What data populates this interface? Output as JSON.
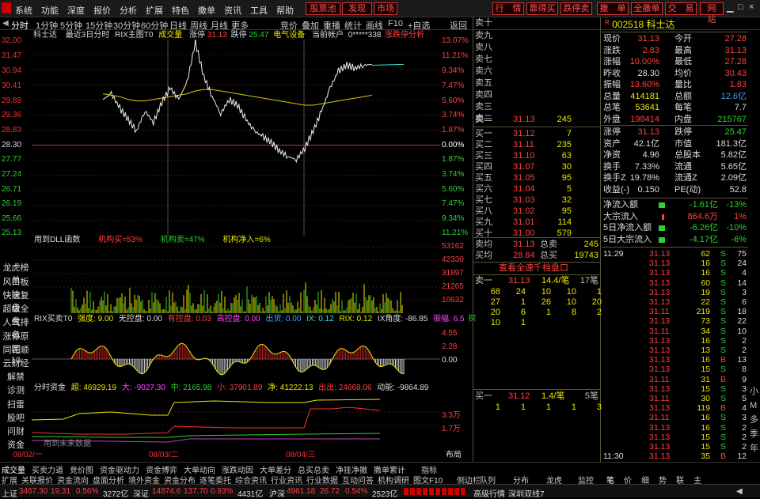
{
  "menu": [
    "系统",
    "功能",
    "深度",
    "报价",
    "分析",
    "扩展",
    "特色",
    "撒单",
    "资讯",
    "工具",
    "帮助"
  ],
  "top_badges": [
    "股票池",
    "发现",
    "市场"
  ],
  "top_buttons": [
    "行　情",
    "靠得买",
    "跌停卖",
    "撒　单",
    "全撒单",
    "交　易",
    "网　站"
  ],
  "tabs": [
    "分时",
    "1分钟",
    "5分钟",
    "15分钟",
    "30分钟",
    "60分钟",
    "日线",
    "周线",
    "月线",
    "更多"
  ],
  "tools": [
    "竞价",
    "叠加",
    "重播",
    "统计",
    "画线",
    "F10",
    "+自选",
    "返回"
  ],
  "chart_header": {
    "name": "科士达",
    "label": "最近3日分时",
    "rix": "RIX主图T0",
    "cjl": "成交量",
    "zt": "涨停",
    "zt_val": "31.13",
    "dt": "跌停",
    "dt_val": "25.47",
    "sector": "电气设备",
    "acct": "当前帐户",
    "acct_val": "0*****338",
    "analysis": "涨跌停分析"
  },
  "price_axis": [
    "32.00",
    "31.47",
    "30.94",
    "30.41",
    "29.89",
    "29.36",
    "28.83",
    "28.30",
    "27.77",
    "27.24",
    "26.71",
    "26.19",
    "25.66",
    "25.13"
  ],
  "pct_axis": [
    "13.07%",
    "11.21%",
    "9.34%",
    "7.47%",
    "5.60%",
    "3.74%",
    "1.87%",
    "0.00%",
    "1.87%",
    "3.74%",
    "5.60%",
    "7.47%",
    "9.34%",
    "11.21%"
  ],
  "dll": {
    "label": "用到DLL函数",
    "buy": "机构买=53%",
    "sell": "机构卖=47%",
    "net": "机构净入=6%"
  },
  "vol_axis": [
    "53162",
    "42330",
    "31897",
    "21265",
    "10632"
  ],
  "rix": {
    "title": "RIX买卖T0",
    "s1": "强度: 9.00",
    "s2": "无控盘: 0.00",
    "s3": "有控盘: 0.03",
    "s4": "高控盘: 0.00",
    "s5": "出货: 0.00",
    "s6": "IX: 0.12",
    "s7": "RIX: 0.12",
    "s8": "IX角度: -86.85",
    "s9": "振幅: 6.5",
    "s10": "探"
  },
  "rix_axis": [
    "4.55",
    "2.28",
    "0.00"
  ],
  "fund": {
    "title": "分时资金",
    "super": "超: 46929.19",
    "big": "大: -9027.30",
    "mid": "中: 2165.98",
    "small": "小: 37901.89",
    "net": "净: 41222.13",
    "out": "出出: 24668.06",
    "power": "动能: -9864.89"
  },
  "fund_axis": [
    "3.3万",
    "1.7万"
  ],
  "fund_note": "用到未来数据",
  "dates": [
    "08/02/一",
    "08/03/二",
    "08/04/三"
  ],
  "layout_btn": "布局",
  "left_items": [
    "龙虎榜单",
    "风口板块",
    "快速复盘",
    "超级全盘",
    "人气排名",
    "涨停原因",
    "同花顺10",
    "云财经",
    "解禁",
    "诊测",
    "扫雷",
    "股吧",
    "问财",
    "资金"
  ],
  "sell_levels": [
    "卖十",
    "卖九",
    "卖八",
    "卖七",
    "卖六",
    "卖五",
    "卖四",
    "卖三",
    "卖二"
  ],
  "sell1": {
    "label": "卖一",
    "price": "31.13",
    "vol": "245"
  },
  "buys": [
    {
      "label": "买一",
      "price": "31.12",
      "vol": "7"
    },
    {
      "label": "买二",
      "price": "31.11",
      "vol": "235"
    },
    {
      "label": "买三",
      "price": "31.10",
      "vol": "63"
    },
    {
      "label": "买四",
      "price": "31.07",
      "vol": "30"
    },
    {
      "label": "买五",
      "price": "31.05",
      "vol": "95"
    },
    {
      "label": "买六",
      "price": "31.04",
      "vol": "5"
    },
    {
      "label": "买七",
      "price": "31.03",
      "vol": "32"
    },
    {
      "label": "买八",
      "price": "31.02",
      "vol": "95"
    },
    {
      "label": "买九",
      "price": "31.01",
      "vol": "114"
    },
    {
      "label": "买十",
      "price": "31.00",
      "vol": "579"
    }
  ],
  "avg": {
    "sell_avg_l": "卖均",
    "sell_avg": "31.13",
    "total_sell_l": "总卖",
    "total_sell": "245",
    "buy_avg_l": "买均",
    "buy_avg": "28.84",
    "total_buy_l": "总买",
    "total_buy": "19743"
  },
  "queue_title": "查看全速千档盘口",
  "queue_sell": {
    "label": "卖一",
    "price": "31.13",
    "qty": "14.4/笔",
    "cnt": "17笔",
    "rows": [
      [
        "68",
        "24",
        "10",
        "10",
        "1"
      ],
      [
        "27",
        "1",
        "26",
        "10",
        "20"
      ],
      [
        "20",
        "6",
        "1",
        "8",
        "2"
      ],
      [
        "10",
        "1",
        "",
        "",
        ""
      ]
    ]
  },
  "queue_buy": {
    "label": "买一",
    "price": "31.12",
    "qty": "1.4/笔",
    "cnt": "5笔",
    "rows": [
      [
        "1",
        "1",
        "1",
        "1",
        "3"
      ]
    ]
  },
  "stock": {
    "code": "002518",
    "name": "科士达"
  },
  "quote": [
    {
      "l": "现价",
      "v": "31.13",
      "l2": "今开",
      "v2": "27.28"
    },
    {
      "l": "涨跌",
      "v": "2.83",
      "l2": "最高",
      "v2": "31.13"
    },
    {
      "l": "涨幅",
      "v": "10.00%",
      "l2": "最低",
      "v2": "27.28"
    },
    {
      "l": "昨收",
      "v": "28.30",
      "l2": "均价",
      "v2": "30.43"
    },
    {
      "l": "振幅",
      "v": "13.60%",
      "l2": "量比",
      "v2": "1.83"
    },
    {
      "l": "总量",
      "v": "414181",
      "l2": "总额",
      "v2": "12.6亿"
    },
    {
      "l": "总笔",
      "v": "53641",
      "l2": "每笔",
      "v2": "7.7"
    },
    {
      "l": "外盘",
      "v": "198414",
      "l2": "内盘",
      "v2": "215767"
    }
  ],
  "fin": [
    {
      "l": "涨停",
      "v": "31.13",
      "l2": "跌停",
      "v2": "25.47"
    },
    {
      "l": "资产",
      "v": "42.1亿",
      "l2": "市值",
      "v2": "181.3亿"
    },
    {
      "l": "净资",
      "v": "4.96",
      "l2": "总股本",
      "v2": "5.82亿"
    },
    {
      "l": "换手",
      "v": "7.33%",
      "l2": "流通",
      "v2": "5.65亿"
    },
    {
      "l": "换手Z",
      "v": "19.78%",
      "l2": "流通Z",
      "v2": "2.09亿"
    },
    {
      "l": "收益(-)",
      "v": "0.150",
      "l2": "PE(动)",
      "v2": "52.8"
    }
  ],
  "flow": [
    {
      "l": "净流入额",
      "v": "-1.61亿",
      "p": "-13%"
    },
    {
      "l": "大宗流入",
      "v": "864.6万",
      "p": "1%"
    },
    {
      "l": "5日净流入额",
      "v": "-6.26亿",
      "p": "-10%"
    },
    {
      "l": "5日大宗流入",
      "v": "-4.17亿",
      "p": "-6%"
    }
  ],
  "ticks": [
    [
      "11:29",
      "31.13",
      "62",
      "S",
      "75"
    ],
    [
      "",
      "31.13",
      "16",
      "S",
      "24"
    ],
    [
      "",
      "31.13",
      "16",
      "S",
      "4"
    ],
    [
      "",
      "31.13",
      "60",
      "S",
      "14"
    ],
    [
      "",
      "31.13",
      "19",
      "S",
      "3"
    ],
    [
      "",
      "31.13",
      "22",
      "S",
      "6"
    ],
    [
      "",
      "31.11",
      "219",
      "S",
      "18"
    ],
    [
      "",
      "31.13",
      "73",
      "S",
      "22"
    ],
    [
      "",
      "31.11",
      "34",
      "S",
      "10"
    ],
    [
      "",
      "31.13",
      "16",
      "S",
      "2"
    ],
    [
      "",
      "31.13",
      "13",
      "S",
      "2"
    ],
    [
      "",
      "31.13",
      "16",
      "B",
      "13"
    ],
    [
      "",
      "31.13",
      "15",
      "S",
      "8"
    ],
    [
      "",
      "31.11",
      "31",
      "B",
      "9"
    ],
    [
      "",
      "31.13",
      "15",
      "S",
      "3"
    ],
    [
      "",
      "31.11",
      "30",
      "S",
      "5"
    ],
    [
      "",
      "31.13",
      "119",
      "B",
      "4"
    ],
    [
      "",
      "31.11",
      "16",
      "S",
      "3"
    ],
    [
      "",
      "31.13",
      "16",
      "S",
      "2"
    ],
    [
      "",
      "31.13",
      "15",
      "S",
      "2"
    ],
    [
      "",
      "31.13",
      "15",
      "S",
      "2"
    ],
    [
      "11:30",
      "31.13",
      "35",
      "B",
      "12"
    ]
  ],
  "side_tabs": [
    "小",
    "M",
    "多",
    "季",
    "年"
  ],
  "bottom_tabs": [
    "成交量",
    "买卖力道",
    "竞价图",
    "资金驱动力",
    "资金博弈",
    "大单动向",
    "涨跌动因",
    "大单差分",
    "总买总卖",
    "净挂净撤",
    "撒单累计",
    "指标"
  ],
  "bottom_tabs2": [
    "扩展",
    "关联报价",
    "资金流向",
    "盘面分析",
    "境外资金",
    "资金分布",
    "逐笔委托",
    "综合资讯",
    "行业资讯",
    "行业数据",
    "互动问答",
    "机构调研",
    "图文F10",
    "侧边栏"
  ],
  "right_bottom_tabs": [
    "队列",
    "分布",
    "龙虎",
    "监控",
    "笔",
    "价",
    "细",
    "势",
    "联",
    "主"
  ],
  "status": {
    "sh_l": "上证",
    "sh": "3467.30",
    "sh_c": "19.31",
    "sh_p": "0.56%",
    "sh_a": "3272亿",
    "sz_l": "深证",
    "sz": "14874.6",
    "sz_c": "137.70",
    "sz_p": "0.93%",
    "sz_a": "4431亿",
    "hs_l": "沪深",
    "hs": "4961.18",
    "hs_c": "26.72",
    "hs_p": "0.54%",
    "hs_a": "2523亿",
    "gj": "高级行情",
    "srv": "深圳双线7"
  },
  "chart_data": {
    "type": "line",
    "title": "科士达 最近3日分时",
    "ylabel": "",
    "ylim": [
      25.13,
      32.0
    ],
    "prev_close": 28.3,
    "x": [
      "08/02",
      "08/03",
      "08/04"
    ],
    "series": [
      {
        "values": [
          29.9,
          30.1,
          29.6,
          29.2,
          28.8,
          29.5,
          29.1,
          29.8,
          30.3,
          29.9,
          30.5,
          31.9,
          30.7,
          30.0,
          29.4,
          29.9,
          29.7,
          29.2,
          28.8,
          28.6,
          28.4,
          28.1,
          27.9,
          27.8,
          28.2,
          28.8,
          29.5,
          30.3,
          30.9,
          31.1,
          31.0,
          31.1,
          31.13
        ]
      },
      {
        "values": [
          30.1,
          30.05,
          30.0,
          29.9,
          29.85,
          29.85,
          29.9,
          29.95,
          30.0,
          30.05,
          30.1,
          30.2,
          30.25,
          30.25,
          30.2,
          30.15,
          30.1,
          30.05,
          30.0,
          29.95,
          29.9,
          29.85,
          29.8,
          29.75,
          29.7,
          29.7,
          29.75,
          29.8,
          29.85,
          29.9,
          29.95,
          30.0,
          30.05
        ]
      }
    ]
  }
}
